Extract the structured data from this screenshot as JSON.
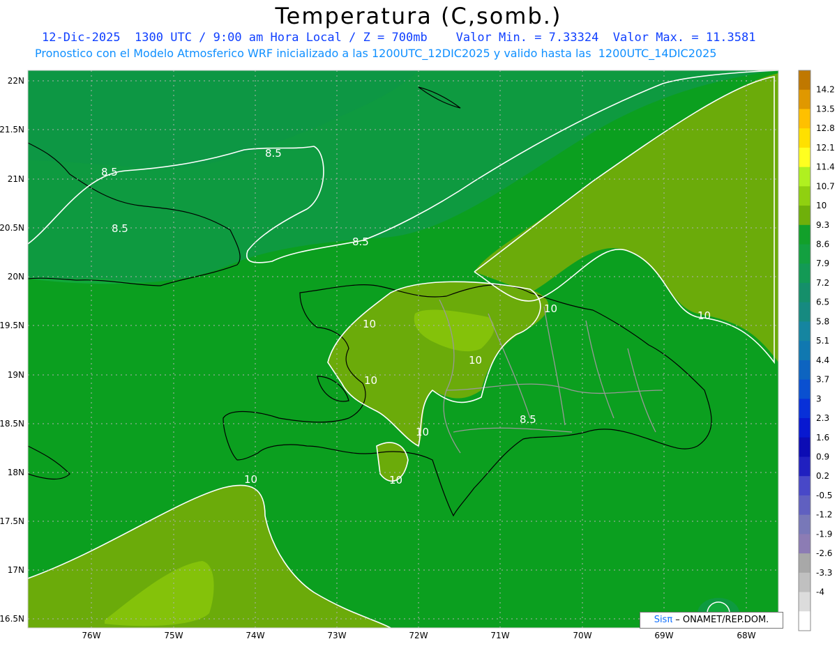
{
  "header": {
    "title": "Temperatura (C,somb.)",
    "line1": "12-Dic-2025  1300 UTC / 9:00 am Hora Local / Z = 700mb    Valor Min. = 7.33324  Valor Max. = 11.3581",
    "line2": "Pronostico con el Modelo Atmosferico WRF inicializado a las 1200UTC_12DIC2025 y valido hasta las  1200UTC_14DIC2025"
  },
  "map": {
    "lat_labels": [
      "22N",
      "21.5N",
      "21N",
      "20.5N",
      "20N",
      "19.5N",
      "19N",
      "18.5N",
      "18N",
      "17.5N",
      "17N",
      "16.5N"
    ],
    "lon_labels": [
      "76W",
      "75W",
      "74W",
      "73W",
      "72W",
      "71W",
      "70W",
      "69W",
      "68W"
    ],
    "contour_labels": [
      "8.5",
      "8.5",
      "8.5",
      "8.5",
      "8.5",
      "10",
      "10",
      "10",
      "10",
      "10",
      "10",
      "10",
      "10"
    ],
    "colors": {
      "t86": "#12a83a",
      "t93": "#0b9f1f",
      "t10": "#6bab0a",
      "t107": "#84c20a",
      "t79": "#0e9a40"
    }
  },
  "colorbar": {
    "labels": [
      "14.2",
      "13.5",
      "12.8",
      "12.1",
      "11.4",
      "10.7",
      "10",
      "9.3",
      "8.6",
      "7.9",
      "7.2",
      "6.5",
      "5.8",
      "5.1",
      "4.4",
      "3.7",
      "3",
      "2.3",
      "1.6",
      "0.9",
      "0.2",
      "-0.5",
      "-1.2",
      "-1.9",
      "-2.6",
      "-3.3",
      "-4"
    ],
    "colors": [
      "#c07800",
      "#e09800",
      "#ffc000",
      "#ffe000",
      "#ffff20",
      "#b0f020",
      "#90d010",
      "#6fb00a",
      "#12a02a",
      "#13a040",
      "#139a55",
      "#158f6a",
      "#168a80",
      "#1585a0",
      "#1078b0",
      "#0d64c0",
      "#0a50d0",
      "#0830d8",
      "#0818d0",
      "#0c0cb4",
      "#2020c0",
      "#4848c8",
      "#6060c0",
      "#7878b8",
      "#8c7cb4",
      "#a8a8a8",
      "#c0c0c0",
      "#dcdcdc",
      "#ffffff"
    ]
  },
  "credit": {
    "brand": "Sisπ",
    "text": " – ONAMET/REP.DOM."
  }
}
